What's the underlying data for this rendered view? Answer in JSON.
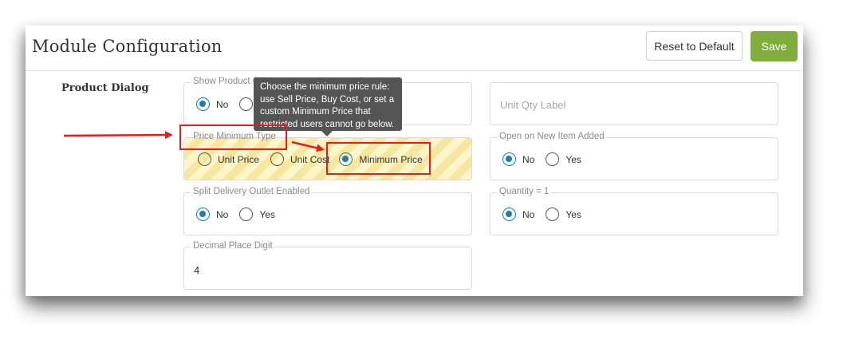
{
  "header": {
    "title": "Module Configuration",
    "reset_label": "Reset to Default",
    "save_label": "Save",
    "save_color": "#7fae3a"
  },
  "section": {
    "label": "Product Dialog"
  },
  "fields": {
    "show_product": {
      "legend": "Show Product C",
      "options": [
        "No",
        ""
      ],
      "selected": "No"
    },
    "unit_qty_label": {
      "placeholder": "Unit Qty Label"
    },
    "price_minimum_type": {
      "legend": "Price Minimum Type",
      "options": [
        "Unit Price",
        "Unit Cost",
        "Minimum Price"
      ],
      "selected": "Minimum Price"
    },
    "open_on_new_item": {
      "legend": "Open on New Item Added",
      "options": [
        "No",
        "Yes"
      ],
      "selected": "No"
    },
    "split_delivery": {
      "legend": "Split Delivery Outlet Enabled",
      "options": [
        "No",
        "Yes"
      ],
      "selected": "No"
    },
    "quantity_one": {
      "legend": "Quantity = 1",
      "options": [
        "No",
        "Yes"
      ],
      "selected": "No"
    },
    "decimal_place": {
      "legend": "Decimal Place Digit",
      "value": "4"
    }
  },
  "tooltip": {
    "lines": [
      "Choose the minimum price rule:",
      "use Sell Price, Buy Cost, or set a",
      "custom Minimum Price that",
      "restricted users cannot go below."
    ]
  },
  "colors": {
    "radio_active": "#1c7bb8",
    "annotation_red": "#e41e1e",
    "stripe_light": "#fdf6c9",
    "stripe_dark": "#f5e7a2"
  }
}
